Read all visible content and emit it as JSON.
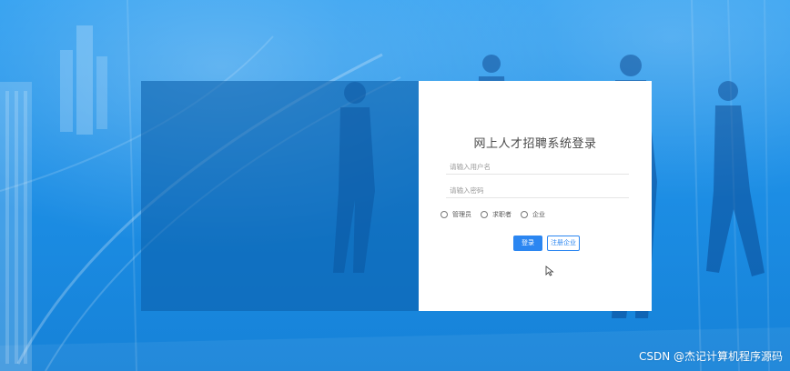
{
  "login": {
    "title": "网上人才招聘系统登录",
    "username_placeholder": "请输入用户名",
    "password_placeholder": "请输入密码",
    "roles": [
      "管理员",
      "求职者",
      "企业"
    ],
    "login_label": "登录",
    "register_label": "注册企业"
  },
  "watermark": "CSDN @杰记计算机程序源码",
  "colors": {
    "background": "#1d8fe6",
    "accent": "#2b86f1",
    "panel_overlay": "#0a5faa"
  }
}
